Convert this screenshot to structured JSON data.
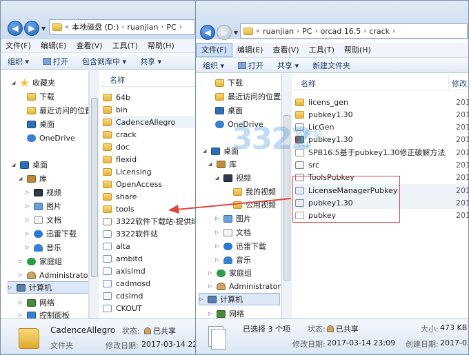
{
  "left_window": {
    "address": [
      "本地磁盘 (D:)",
      "ruanjian",
      "PC"
    ],
    "menu": [
      "文件(F)",
      "编辑(E)",
      "查看(V)",
      "工具(T)",
      "帮助(H)"
    ],
    "toolbar": [
      "组织 ▾",
      "打开",
      "包含到库中 ▾",
      "共享 ▾"
    ],
    "nav": [
      {
        "label": "收藏夹",
        "icon": "star"
      },
      {
        "label": "下载",
        "icon": "fold"
      },
      {
        "label": "最近访问的位置",
        "icon": "fold"
      },
      {
        "label": "桌面",
        "icon": "desk"
      },
      {
        "label": "OneDrive",
        "icon": "cloud"
      },
      {
        "label": "桌面",
        "icon": "desk"
      },
      {
        "label": "库",
        "icon": "lib"
      },
      {
        "label": "视频",
        "icon": "vid"
      },
      {
        "label": "图片",
        "icon": "pic"
      },
      {
        "label": "文档",
        "icon": "doc"
      },
      {
        "label": "迅雷下载",
        "icon": "dl"
      },
      {
        "label": "音乐",
        "icon": "mus"
      },
      {
        "label": "家庭组",
        "icon": "home"
      },
      {
        "label": "Administrator",
        "icon": "user"
      },
      {
        "label": "计算机",
        "icon": "pc"
      },
      {
        "label": "网络",
        "icon": "net"
      },
      {
        "label": "控制面板",
        "icon": "ctl"
      }
    ],
    "column_header": "名称",
    "files": [
      {
        "name": "64b",
        "icon": "fold"
      },
      {
        "name": "bin",
        "icon": "fold"
      },
      {
        "name": "CadenceAllegro",
        "icon": "fold"
      },
      {
        "name": "crack",
        "icon": "fold"
      },
      {
        "name": "doc",
        "icon": "fold"
      },
      {
        "name": "flexid",
        "icon": "fold"
      },
      {
        "name": "Licensing",
        "icon": "fold"
      },
      {
        "name": "OpenAccess",
        "icon": "fold"
      },
      {
        "name": "share",
        "icon": "fold"
      },
      {
        "name": "tools",
        "icon": "fold"
      },
      {
        "name": "3322软件下载站-提供绿",
        "icon": "fileexe"
      },
      {
        "name": "3322软件站",
        "icon": "filelink"
      },
      {
        "name": "alta",
        "icon": "fileapp"
      },
      {
        "name": "ambitd",
        "icon": "fileapp"
      },
      {
        "name": "axislmd",
        "icon": "fileapp"
      },
      {
        "name": "cadmosd",
        "icon": "fileapp"
      },
      {
        "name": "cdslmd",
        "icon": "fileapp"
      },
      {
        "name": "CKOUT",
        "icon": "fileapp"
      }
    ],
    "status": {
      "name": "CadenceAllegro",
      "type": "文件夹",
      "state_label": "状态:",
      "state_value": "已共享",
      "modified_label": "修改日期:",
      "modified_value": "2017-03-14 22:33"
    }
  },
  "right_window": {
    "address": [
      "ruanjian",
      "PC",
      "orcad 16.5",
      "crack"
    ],
    "menu": [
      "文件(F)",
      "编辑(E)",
      "查看(V)",
      "工具(T)",
      "帮助(H)"
    ],
    "toolbar": [
      "组织 ▾",
      "打开",
      "共享 ▾",
      "新建文件夹"
    ],
    "nav": [
      {
        "label": "下载",
        "icon": "fold"
      },
      {
        "label": "最近访问的位置",
        "icon": "fold"
      },
      {
        "label": "桌面",
        "icon": "desk"
      },
      {
        "label": "OneDrive",
        "icon": "cloud"
      },
      {
        "label": "桌面",
        "icon": "desk"
      },
      {
        "label": "库",
        "icon": "lib"
      },
      {
        "label": "视频",
        "icon": "vid"
      },
      {
        "label": "我的视频",
        "icon": "fold"
      },
      {
        "label": "公用视频",
        "icon": "fold"
      },
      {
        "label": "图片",
        "icon": "pic"
      },
      {
        "label": "文档",
        "icon": "doc"
      },
      {
        "label": "迅雷下载",
        "icon": "dl"
      },
      {
        "label": "音乐",
        "icon": "mus"
      },
      {
        "label": "家庭组",
        "icon": "home"
      },
      {
        "label": "Administrator",
        "icon": "user"
      },
      {
        "label": "计算机",
        "icon": "pc"
      },
      {
        "label": "网络",
        "icon": "net"
      }
    ],
    "column_header_name": "名称",
    "column_header_date": "修改",
    "files": [
      {
        "name": "licens_gen",
        "icon": "fold",
        "date": "201"
      },
      {
        "name": "pubkey1.30",
        "icon": "fold",
        "date": "201"
      },
      {
        "name": "LicGen",
        "icon": "fileexe",
        "date": "201"
      },
      {
        "name": "pubkey1.30",
        "icon": "filerar",
        "date": "201"
      },
      {
        "name": "SPB16.5基于pubkey1.30修正破解方法",
        "icon": "filetxt",
        "date": "201"
      },
      {
        "name": "src",
        "icon": "fileexe",
        "date": "201"
      },
      {
        "name": "ToolsPubkey",
        "icon": "fileexe",
        "date": "201"
      },
      {
        "name": "LicenseManagerPubkey",
        "icon": "filecfg",
        "date": "201"
      },
      {
        "name": "pubkey1.30",
        "icon": "filecfg",
        "date": "201"
      },
      {
        "name": "pubkey",
        "icon": "filetxt",
        "date": "201"
      }
    ],
    "status": {
      "selected": "已选择 3 个项",
      "state_label": "状态:",
      "state_value": "已共享",
      "size_label": "大小:",
      "size_value": "473 KB",
      "modified_label": "修改日期:",
      "modified_value": "2017-03-14 23:09",
      "created_label": "创建日期:",
      "created_value": "2017-03-1"
    }
  },
  "watermark": {
    "main": "3322",
    "sub": "软件站",
    "small": ".cn"
  },
  "colors": {
    "highlight_box": "#e0443e",
    "arrow": "#e0443e"
  }
}
